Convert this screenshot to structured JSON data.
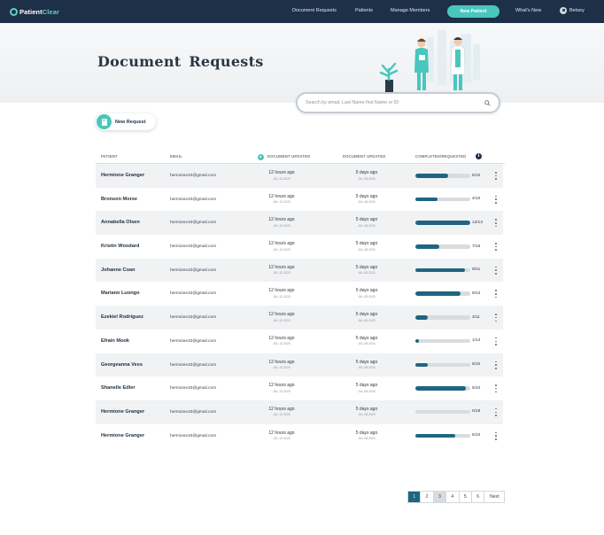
{
  "nav": {
    "logo_part1": "Patient",
    "logo_part2": "Clear",
    "links": [
      "Document Requests",
      "Patients",
      "Manage Members"
    ],
    "new_patient": "New Patient",
    "whats_new": "What's New",
    "user": "Betsey"
  },
  "page": {
    "title": "Document  Requests",
    "search_placeholder": "Search by email, Last Name first Name or ID",
    "new_request": "New Request"
  },
  "table": {
    "headers": [
      "PATIENT",
      "EMAIL",
      "DOCUMENT UPDATED",
      "DOCUMENT UPDATED",
      "COMPLETED/REQUESTED"
    ],
    "rows": [
      {
        "name": "Hermione Granger",
        "email": "hermione10@gmail.com",
        "upd1": "12 hours ago",
        "upd1_date": "JUL-12-2020",
        "upd2": "5 days ago",
        "upd2_date": "JUL-08-2020",
        "count": "6/10",
        "progress": 0.6
      },
      {
        "name": "Bronson Morse",
        "email": "hermione10@gmail.com",
        "upd1": "12 hours ago",
        "upd1_date": "JUL-12-2020",
        "upd2": "5 days ago",
        "upd2_date": "JUL-08-2020",
        "count": "4/10",
        "progress": 0.4
      },
      {
        "name": "Annabella Olsen",
        "email": "hermione10@gmail.com",
        "upd1": "12 hours ago",
        "upd1_date": "JUL-12-2020",
        "upd2": "5 days ago",
        "upd2_date": "JUL-08-2020",
        "count": "13/13",
        "progress": 1.0
      },
      {
        "name": "Kristin Woodard",
        "email": "hermione10@gmail.com",
        "upd1": "12 hours ago",
        "upd1_date": "JUL-12-2020",
        "upd2": "5 days ago",
        "upd2_date": "JUL-08-2020",
        "count": "7/16",
        "progress": 0.44
      },
      {
        "name": "Johanne Coan",
        "email": "hermione10@gmail.com",
        "upd1": "12 hours ago",
        "upd1_date": "JUL-12-2020",
        "upd2": "5 days ago",
        "upd2_date": "JUL-08-2020",
        "count": "9/21",
        "progress": 0.9
      },
      {
        "name": "Mariano Luongo",
        "email": "hermione10@gmail.com",
        "upd1": "12 hours ago",
        "upd1_date": "JUL-12-2020",
        "upd2": "5 days ago",
        "upd2_date": "JUL-08-2020",
        "count": "9/12",
        "progress": 0.83
      },
      {
        "name": "Ezekiel Rodriguez",
        "email": "hermione10@gmail.com",
        "upd1": "12 hours ago",
        "upd1_date": "JUL-12-2020",
        "upd2": "5 days ago",
        "upd2_date": "JUL-08-2020",
        "count": "3/11",
        "progress": 0.22
      },
      {
        "name": "Efrain Mook",
        "email": "hermione10@gmail.com",
        "upd1": "12 hours ago",
        "upd1_date": "JUL-12-2020",
        "upd2": "5 days ago",
        "upd2_date": "JUL-08-2020",
        "count": "1/14",
        "progress": 0.07
      },
      {
        "name": "Georgeanna Vess",
        "email": "hermione10@gmail.com",
        "upd1": "12 hours ago",
        "upd1_date": "JUL-12-2020",
        "upd2": "5 days ago",
        "upd2_date": "JUL-08-2020",
        "count": "6/10",
        "progress": 0.22
      },
      {
        "name": "Shanelle Edler",
        "email": "hermione10@gmail.com",
        "upd1": "12 hours ago",
        "upd1_date": "JUL-12-2020",
        "upd2": "5 days ago",
        "upd2_date": "JUL-08-2020",
        "count": "6/10",
        "progress": 0.92
      },
      {
        "name": "Hermione Granger",
        "email": "hermione10@gmail.com",
        "upd1": "12 hours ago",
        "upd1_date": "JUL-12-2020",
        "upd2": "5 days ago",
        "upd2_date": "JUL-08-2020",
        "count": "0/18",
        "progress": 0.0
      },
      {
        "name": "Hermione Granger",
        "email": "hermione10@gmail.com",
        "upd1": "12 hours ago",
        "upd1_date": "JUL-12-2020",
        "upd2": "5 days ago",
        "upd2_date": "JUL-08-2020",
        "count": "6/10",
        "progress": 0.73
      }
    ]
  },
  "pagination": {
    "pages": [
      "1",
      "2",
      "3",
      "4",
      "5",
      "6"
    ],
    "active": "1",
    "next": "Next"
  },
  "colors": {
    "nav_bg": "#1e3048",
    "accent": "#49c6bd",
    "progress": "#1f6582"
  }
}
